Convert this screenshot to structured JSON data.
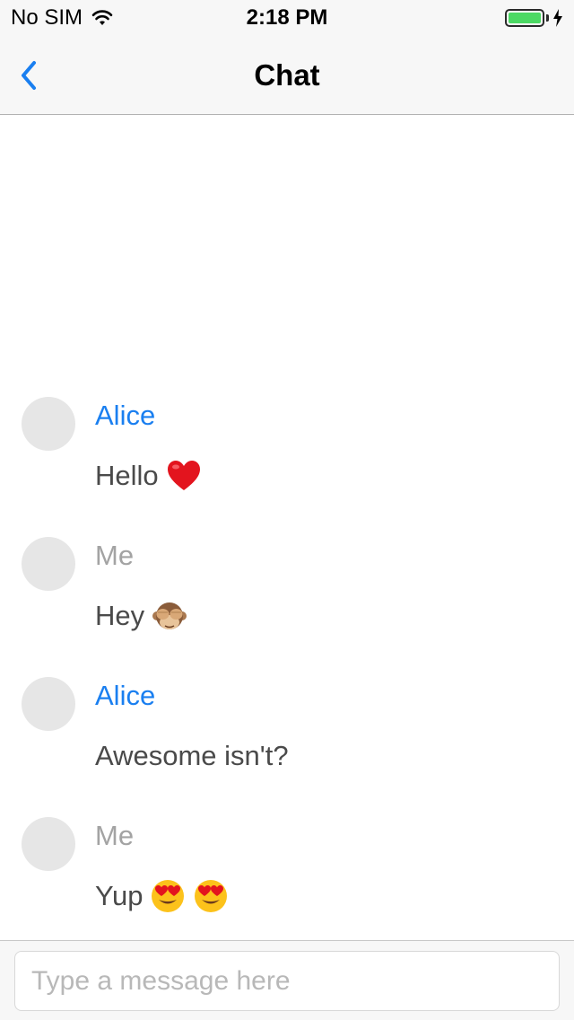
{
  "status_bar": {
    "carrier": "No SIM",
    "time": "2:18 PM",
    "battery_level": 1.0
  },
  "nav": {
    "title": "Chat",
    "back_icon": "chevron-left-icon"
  },
  "messages": [
    {
      "sender": "Alice",
      "text": "Hello",
      "emojis": [
        "red-heart-emoji"
      ],
      "from_me": false
    },
    {
      "sender": "Me",
      "text": "Hey",
      "emojis": [
        "see-no-evil-monkey-emoji"
      ],
      "from_me": true
    },
    {
      "sender": "Alice",
      "text": "Awesome isn't?",
      "emojis": [],
      "from_me": false
    },
    {
      "sender": "Me",
      "text": "Yup",
      "emojis": [
        "heart-eyes-emoji",
        "heart-eyes-emoji"
      ],
      "from_me": true
    }
  ],
  "input": {
    "placeholder": "Type a message here",
    "value": ""
  },
  "colors": {
    "accent": "#1a7ff0",
    "me_name": "#a3a3a3",
    "battery": "#4cd964",
    "avatar": "#e6e6e6"
  }
}
